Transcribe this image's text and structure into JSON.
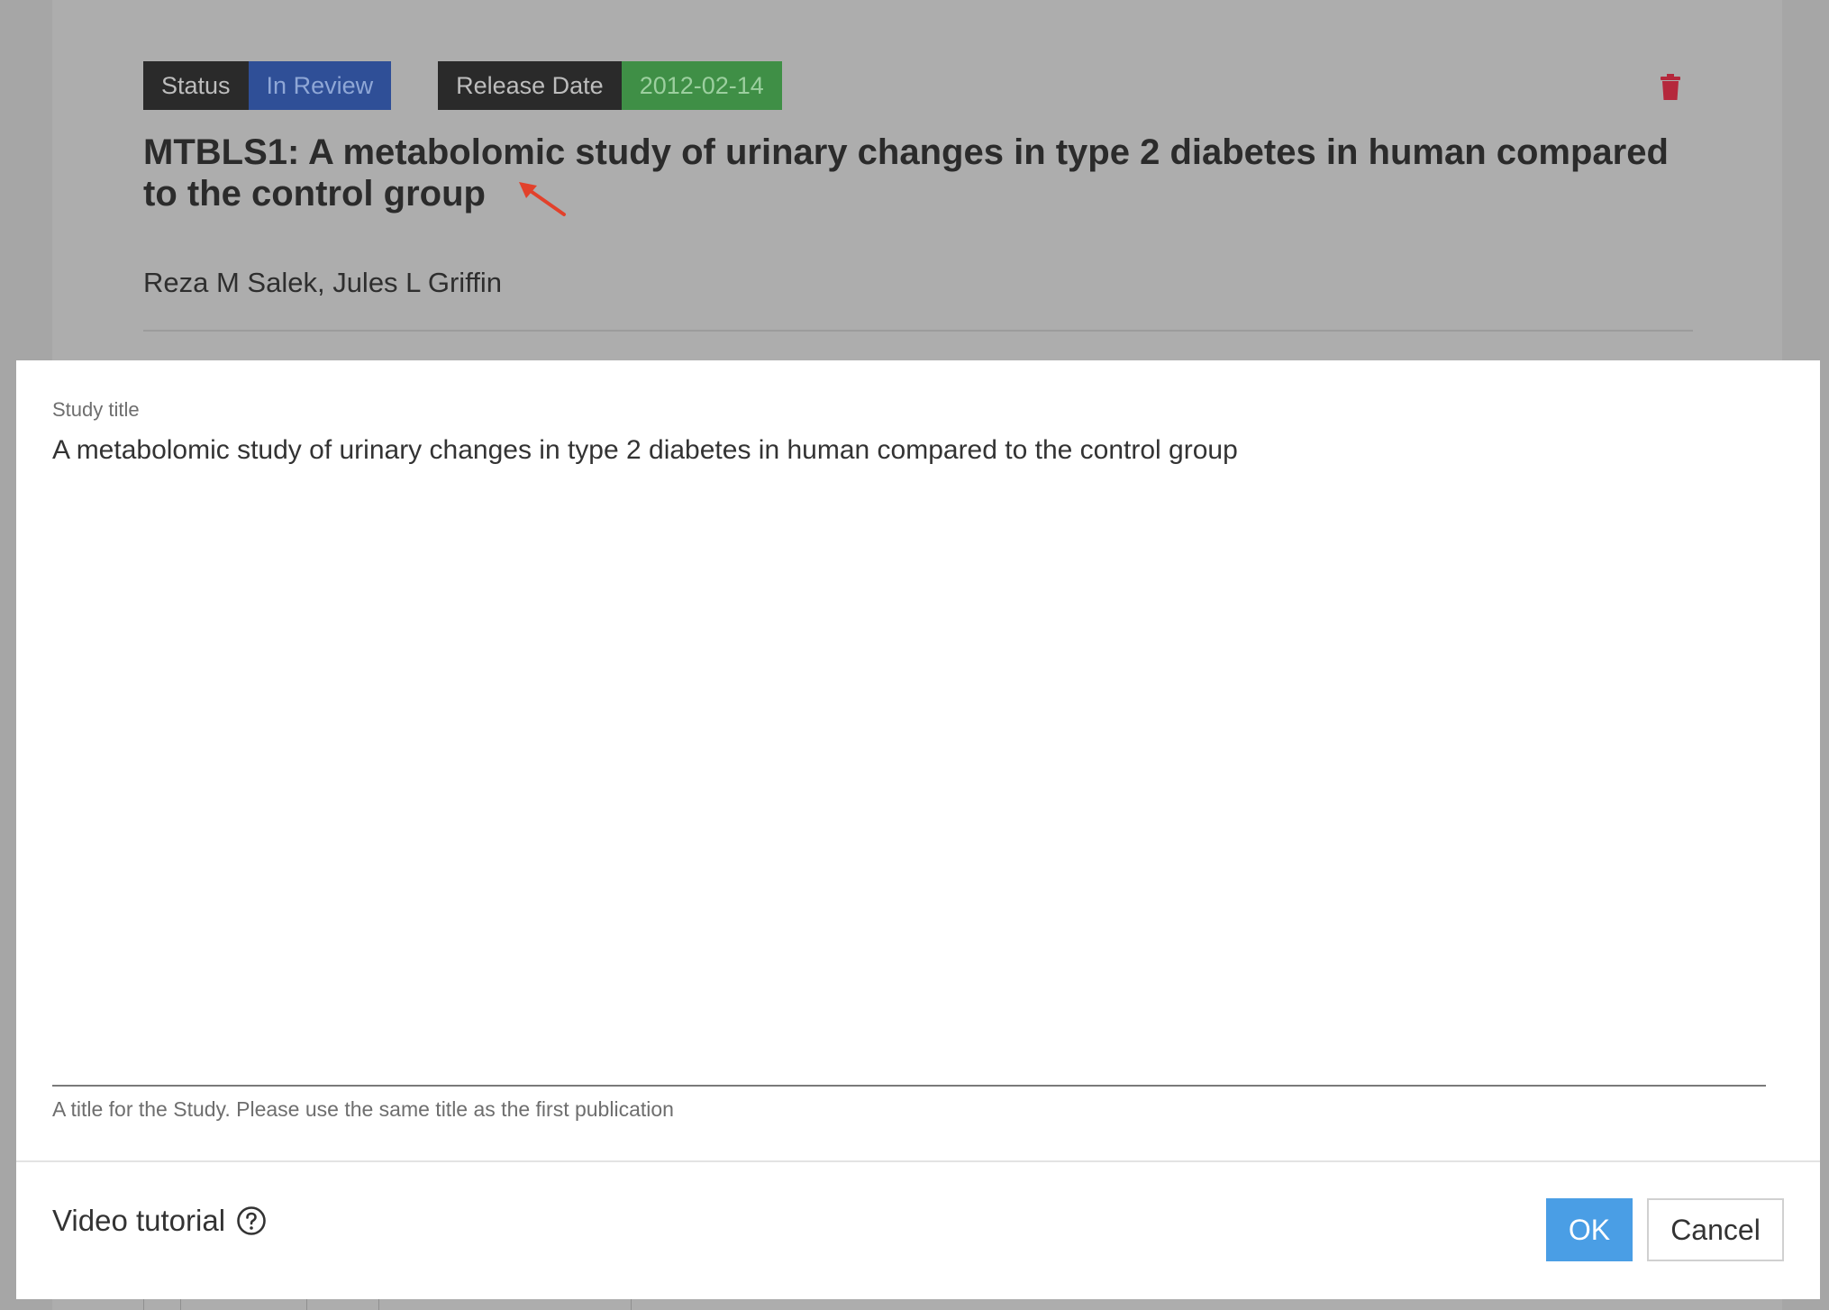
{
  "background": {
    "status": {
      "label": "Status",
      "value": "In Review"
    },
    "release": {
      "label": "Release Date",
      "value": "2012-02-14"
    },
    "study_heading": "MTBLS1: A metabolomic study of urinary changes in type 2 diabetes in human compared to the control group",
    "authors": "Reza M Salek, Jules L Griffin",
    "icons": {
      "delete": "trash-icon",
      "annotation": "arrow-icon"
    }
  },
  "modal": {
    "field_label": "Study title",
    "title_value": "A metabolomic study of urinary changes in type 2 diabetes in human compared to the control group",
    "hint": "A title for the Study. Please use the same title as the first publication",
    "video_tutorial": "Video tutorial",
    "help_icon": "question-circle-icon",
    "ok_label": "OK",
    "cancel_label": "Cancel"
  },
  "colors": {
    "overlay": "#a6a6a6",
    "status_blue": "#2f4f97",
    "release_green": "#3f8f46",
    "delete_red": "#b5283c",
    "annotation_arrow": "#e2412b",
    "ok_button": "#4a9ee5"
  }
}
